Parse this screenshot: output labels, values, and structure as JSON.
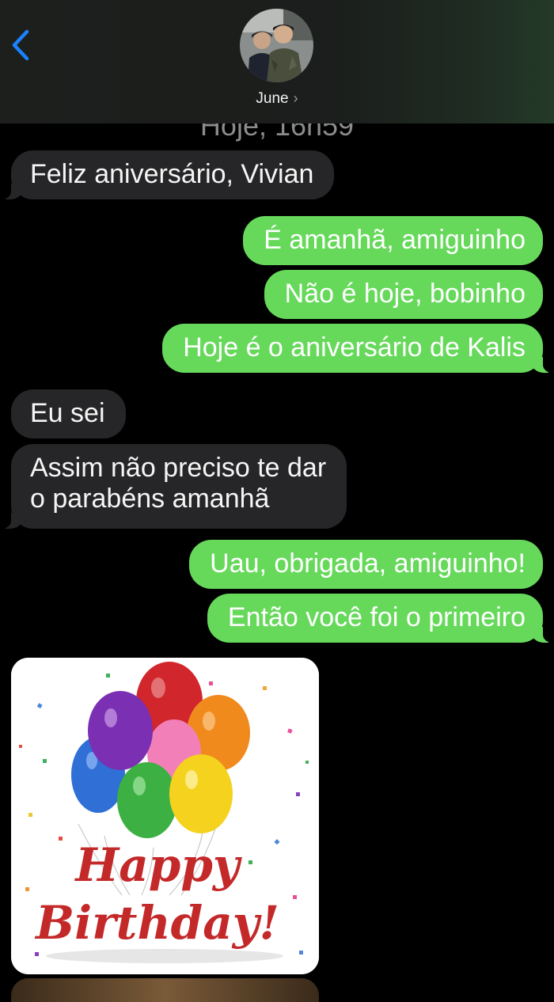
{
  "header": {
    "contact_name": "June",
    "chevron": "›",
    "back_icon": "chevron-left-icon",
    "accent": "#1a82ff"
  },
  "timestamp": "Hoje, 16h59",
  "messages": [
    {
      "dir": "in",
      "text": "Feliz aniversário, Vivian"
    },
    {
      "dir": "out",
      "text": "É amanhã, amiguinho"
    },
    {
      "dir": "out",
      "text": "Não é hoje, bobinho"
    },
    {
      "dir": "out",
      "text": "Hoje é o aniversário de Kalis"
    },
    {
      "dir": "in",
      "text": "Eu sei"
    },
    {
      "dir": "in",
      "text": "Assim não preciso te dar"
    },
    {
      "dir": "in",
      "text": "o parabéns amanhã"
    },
    {
      "dir": "out",
      "text": "Uau, obrigada, amiguinho!"
    },
    {
      "dir": "out",
      "text": "Então você foi o primeiro"
    }
  ],
  "attachment": {
    "line1": "Happy",
    "line2": "Birthday!",
    "balloon_colors": [
      "#d1262c",
      "#7b2fb2",
      "#f08a1d",
      "#2f6fd6",
      "#f27fb8",
      "#3db043",
      "#f4d21d"
    ]
  },
  "colors": {
    "incoming_bubble": "#262628",
    "outgoing_bubble": "#66d95b",
    "background": "#000000"
  }
}
